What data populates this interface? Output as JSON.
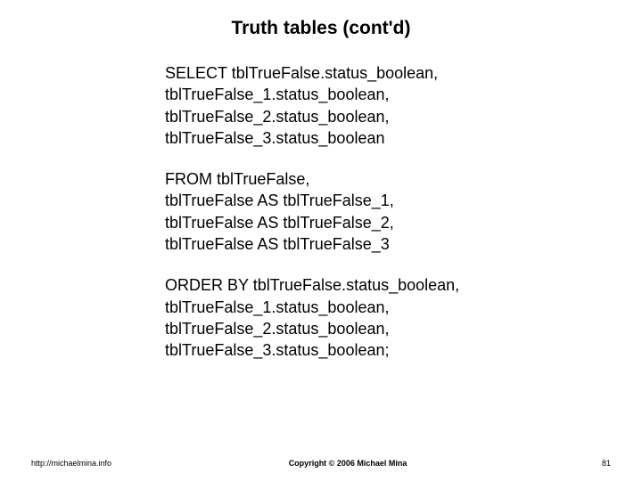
{
  "title": "Truth tables (cont'd)",
  "block1": {
    "l1": "SELECT tblTrueFalse.status_boolean,",
    "l2": "tblTrueFalse_1.status_boolean,",
    "l3": "tblTrueFalse_2.status_boolean,",
    "l4": "tblTrueFalse_3.status_boolean"
  },
  "block2": {
    "l1": "FROM tblTrueFalse,",
    "l2": "tblTrueFalse AS tblTrueFalse_1,",
    "l3": "tblTrueFalse AS tblTrueFalse_2,",
    "l4": "tblTrueFalse AS tblTrueFalse_3"
  },
  "block3": {
    "l1": "ORDER BY tblTrueFalse.status_boolean,",
    "l2": "tblTrueFalse_1.status_boolean,",
    "l3": "tblTrueFalse_2.status_boolean,",
    "l4": "tblTrueFalse_3.status_boolean;"
  },
  "footer": {
    "url": "http://michaelmina.info",
    "copyright": "Copyright © 2006 Michael Mina",
    "page": "81"
  }
}
